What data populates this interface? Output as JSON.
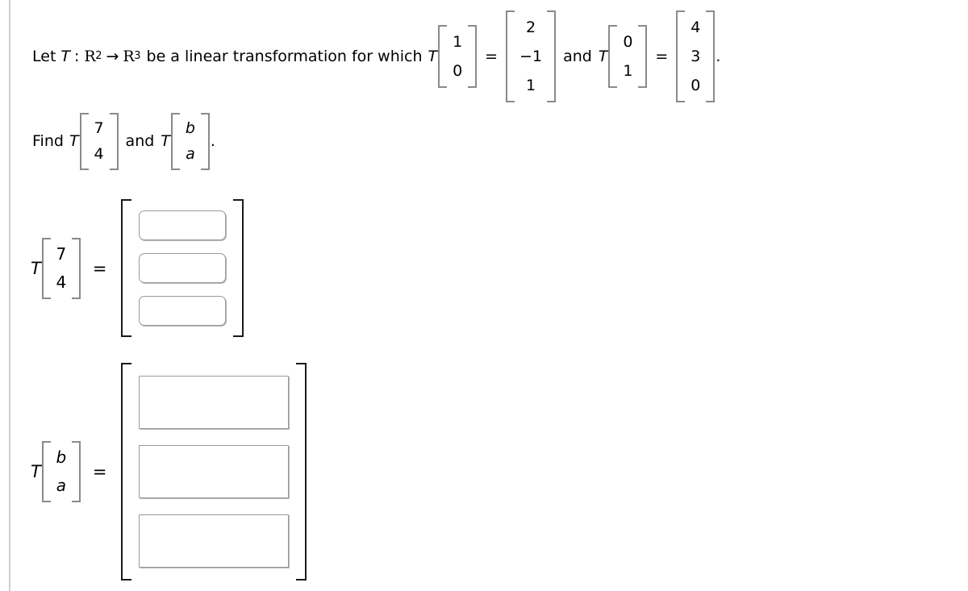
{
  "problem": {
    "statement": {
      "lead": "Let",
      "transform_symbol": "T",
      "colon": ":",
      "domain_symbol": "R",
      "domain_exponent": "2",
      "arrow": "→",
      "codomain_symbol": "R",
      "codomain_exponent": "3",
      "middle": "be a linear transformation for which",
      "conjunction": "and",
      "terminator": "."
    },
    "given": [
      {
        "map_symbol": "T",
        "input_vector": [
          "1",
          "0"
        ],
        "equals": "=",
        "output_vector": [
          "2",
          "−1",
          "1"
        ]
      },
      {
        "map_symbol": "T",
        "input_vector": [
          "0",
          "1"
        ],
        "equals": "=",
        "output_vector": [
          "4",
          "3",
          "0"
        ]
      }
    ],
    "instruction": {
      "lead": "Find",
      "map_symbol": "T",
      "first_vector": [
        "7",
        "4"
      ],
      "conjunction": "and",
      "second_map_symbol": "T",
      "second_vector": [
        "b",
        "a"
      ],
      "terminator": "."
    }
  },
  "answers": [
    {
      "name": "answer-numeric",
      "map_symbol": "T",
      "input_vector": [
        "7",
        "4"
      ],
      "equals": "=",
      "fields": [
        {
          "value": "",
          "placeholder": ""
        },
        {
          "value": "",
          "placeholder": ""
        },
        {
          "value": "",
          "placeholder": ""
        }
      ]
    },
    {
      "name": "answer-symbolic",
      "map_symbol": "T",
      "input_vector": [
        "b",
        "a"
      ],
      "equals": "=",
      "fields": [
        {
          "value": "",
          "placeholder": ""
        },
        {
          "value": "",
          "placeholder": ""
        },
        {
          "value": "",
          "placeholder": ""
        }
      ]
    }
  ],
  "colors": {
    "text": "#000000",
    "inline_bracket": "#8a8a8a",
    "answer_bracket": "#1a1a1a",
    "field_border": "#9a9a9a",
    "page_rule": "#cfcfcf",
    "background": "#ffffff"
  }
}
